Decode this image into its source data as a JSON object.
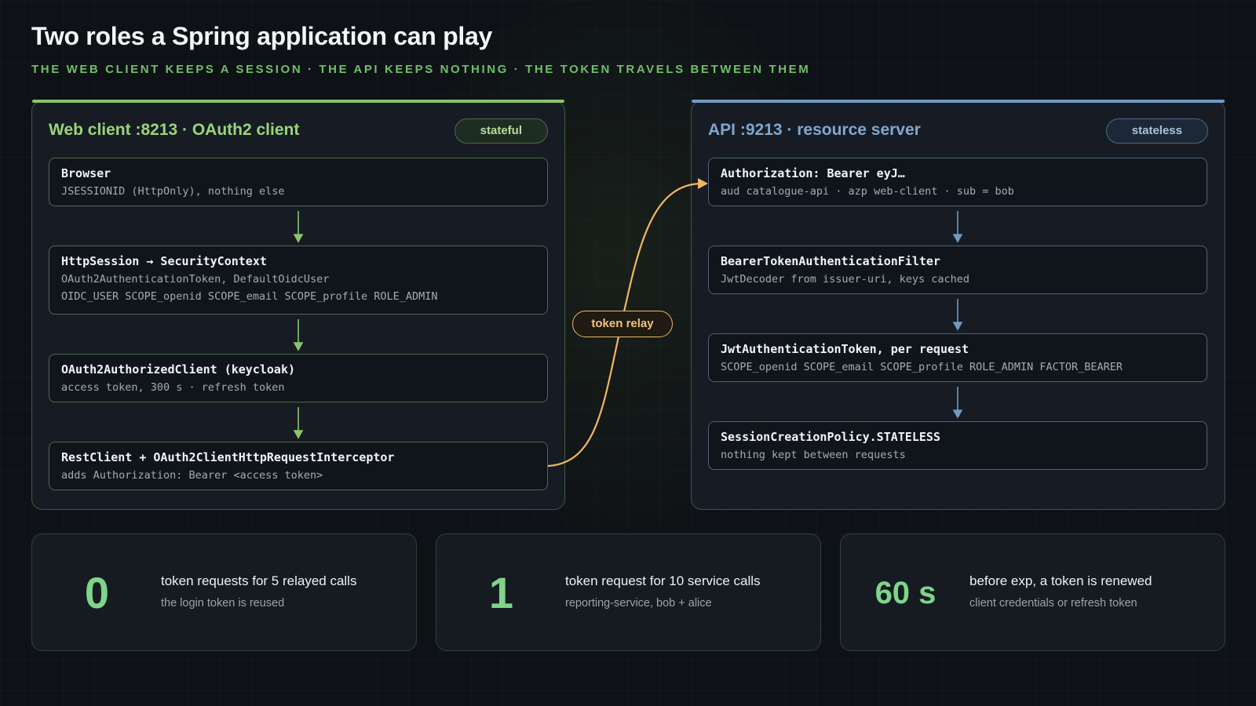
{
  "header": {
    "title": "Two roles a Spring application can play",
    "subtitle": "THE WEB CLIENT KEEPS A SESSION · THE API KEEPS NOTHING · THE TOKEN TRAVELS BETWEEN THEM"
  },
  "colors": {
    "client_accent": "#8ac46a",
    "server_accent": "#6f9ac4",
    "relay_accent": "#f0b860",
    "stat_value": "#7fd48a"
  },
  "client_panel": {
    "title": "Web client :8213 · OAuth2 client",
    "badge": "stateful",
    "boxes": [
      {
        "title": "Browser",
        "lines": [
          "JSESSIONID (HttpOnly), nothing else"
        ]
      },
      {
        "title": "HttpSession → SecurityContext",
        "lines": [
          "OAuth2AuthenticationToken, DefaultOidcUser",
          "OIDC_USER SCOPE_openid SCOPE_email SCOPE_profile ROLE_ADMIN"
        ]
      },
      {
        "title": "OAuth2AuthorizedClient (keycloak)",
        "lines": [
          "access token, 300 s · refresh token"
        ]
      },
      {
        "title": "RestClient + OAuth2ClientHttpRequestInterceptor",
        "lines": [
          "adds Authorization: Bearer <access token>"
        ]
      }
    ]
  },
  "server_panel": {
    "title": "API :9213 · resource server",
    "badge": "stateless",
    "boxes": [
      {
        "title": "Authorization: Bearer eyJ…",
        "lines": [
          "aud catalogue-api · azp web-client · sub = bob"
        ]
      },
      {
        "title": "BearerTokenAuthenticationFilter",
        "lines": [
          "JwtDecoder from issuer-uri, keys cached"
        ]
      },
      {
        "title": "JwtAuthenticationToken, per request",
        "lines": [
          "SCOPE_openid SCOPE_email SCOPE_profile ROLE_ADMIN FACTOR_BEARER"
        ]
      },
      {
        "title": "SessionCreationPolicy.STATELESS",
        "lines": [
          "nothing kept between requests"
        ]
      }
    ]
  },
  "relay": {
    "label": "token relay"
  },
  "stats": [
    {
      "value": "0",
      "label": "token requests for 5 relayed calls",
      "note": "the login token is reused"
    },
    {
      "value": "1",
      "label": "token request for 10 service calls",
      "note": "reporting-service, bob + alice"
    },
    {
      "value": "60 s",
      "label": "before exp, a token is renewed",
      "note": "client credentials or refresh token"
    }
  ]
}
